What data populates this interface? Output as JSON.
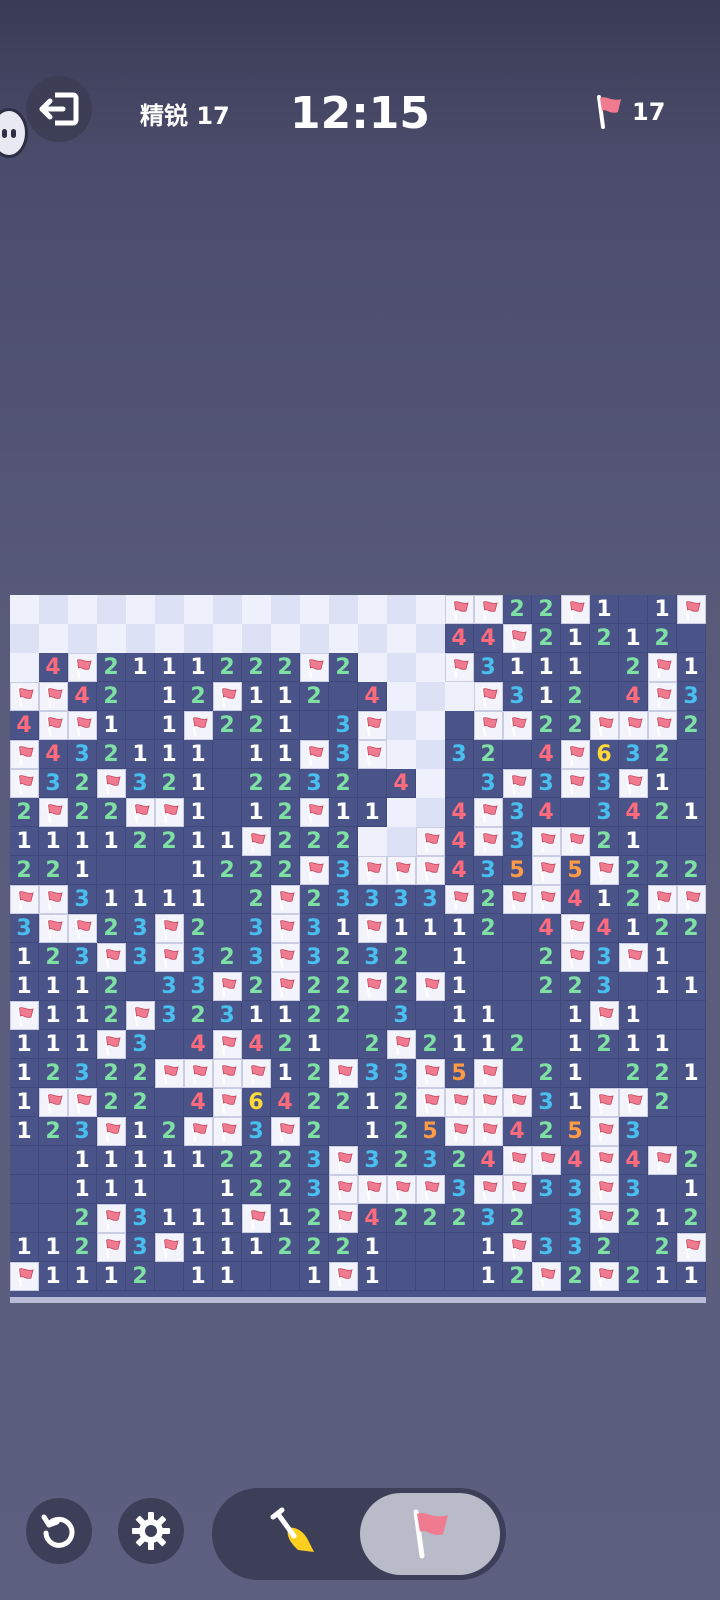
{
  "header": {
    "level_label": "精锐 17",
    "timer": "12:15",
    "flag_count": "17"
  },
  "icons": {
    "exit": "exit-door-icon",
    "side_bubble": "side-chat-bubble-icon",
    "flag": "flag-icon",
    "undo": "undo-icon",
    "settings": "gear-icon",
    "shovel": "shovel-icon"
  },
  "colors": {
    "1": "#ffffff",
    "2": "#7fe0a3",
    "3": "#49bff0",
    "4": "#ff6b7d",
    "5": "#ff9a45",
    "6": "#ffd93a",
    "revealed": "#4a5488",
    "flag": "#f07a8f"
  },
  "board": {
    "cols": 24,
    "rows": 24,
    "legend": "u = unrevealed, F = flag, . = revealed empty, digit = mine count",
    "grid": [
      "uuuuuuuuuuuuuuuFF22F1.1F",
      "uuuuuuuuuuuuuuu44F21212 1",
      "u4F2111222F2uuuF3111 2F1.",
      "FF42.12F112 4uuuF312 4F31.",
      "4FF1.1F221 3Fuu FF22FFF2..",
      "F432111 11F3Fuu32 4F632..",
      "F32F321.2232 4u 3F3F3F1..",
      "2F22FF1 12F11uu4F34 3421..",
      "11112211F222uuF4F3FF21..",
      "221...1222F3FFF435F5F222",
      "FF31111.2F23333F2FF412FF",
      "3FF23F2.3F31F1112 4F41222",
      "123F3F323F3232 1..2F3F1..",
      "1112 33F2F22F2F1..223 11..",
      "F112F3231122 3 11..1F1....",
      "111F3 4F421 2F2112 1211...",
      "12322FFFF12F33F5F 21 221.",
      "1FF22 4F642212FFFF31FF2..",
      "123F12FF3F2.125FF425F3..",
      "..111112223F32324FF4F4F211",
      "..111..1223FFFF3FF33F3 11F",
      "..2F3111F12F422232 3F212 2",
      "112F3F1112221...1F332 2F1",
      "F1112 11..1F1...12F2F211"
    ]
  }
}
